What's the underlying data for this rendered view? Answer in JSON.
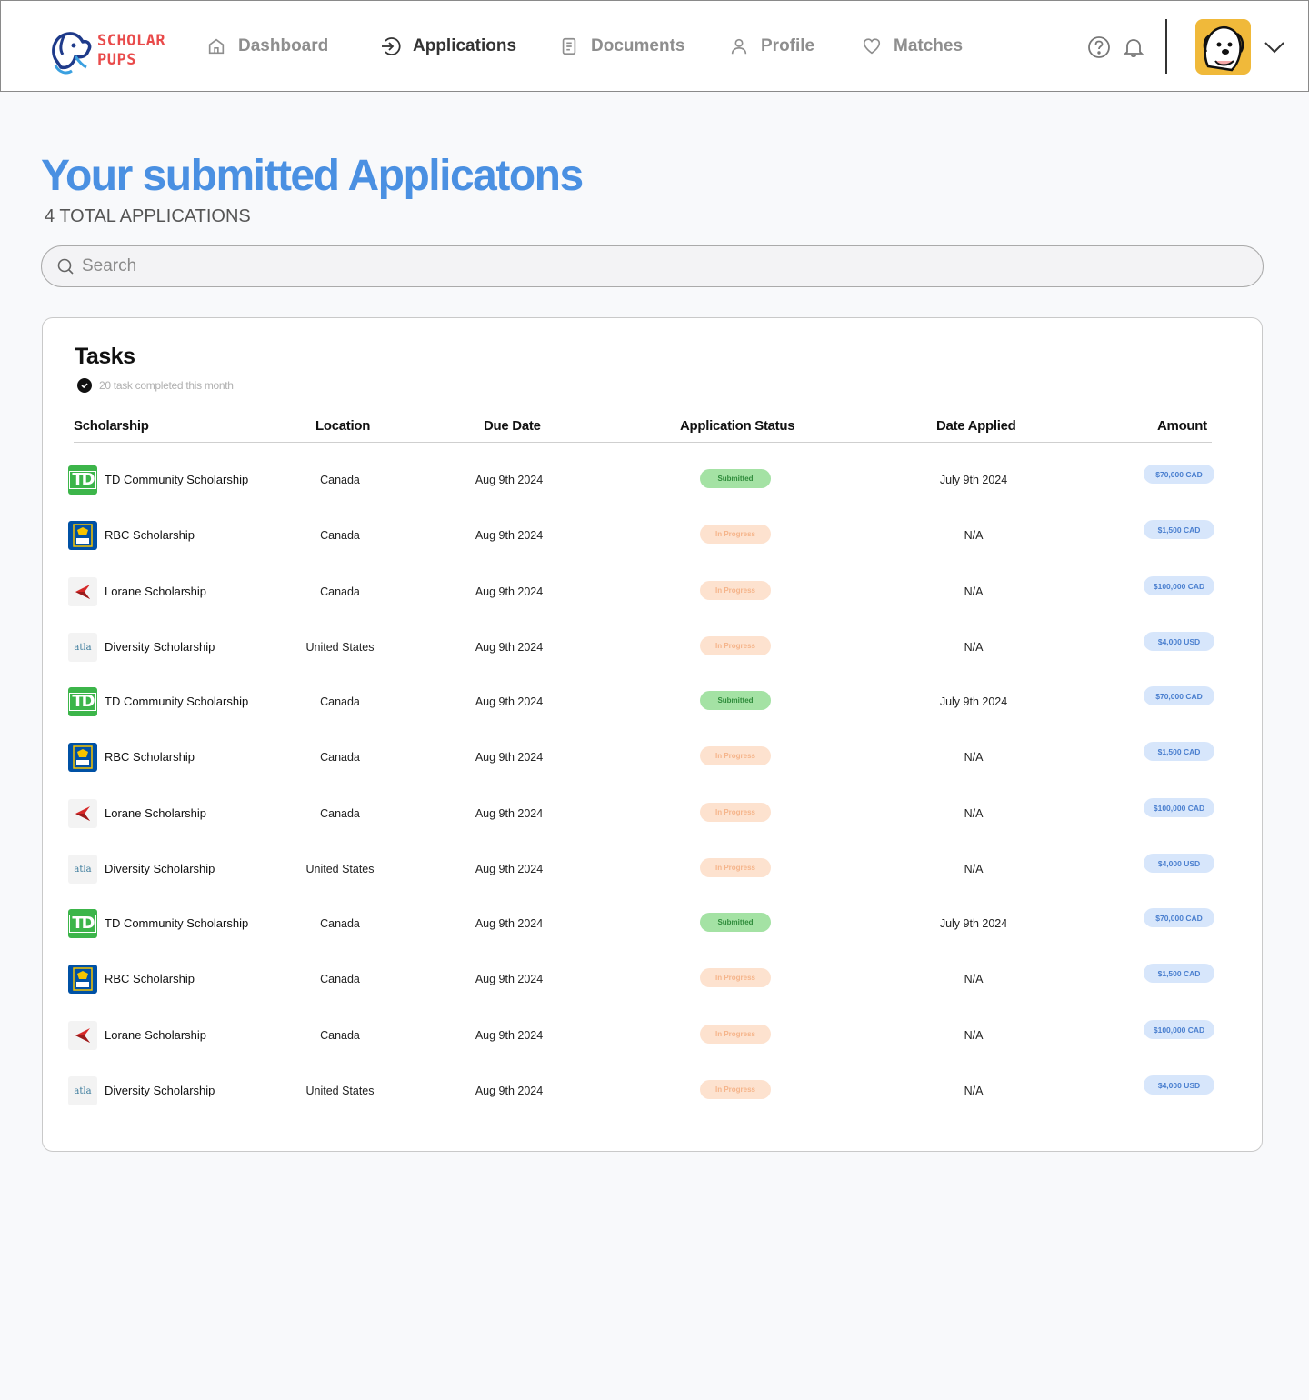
{
  "brand": {
    "line1": "SCHOLAR",
    "line2": "PUPS"
  },
  "nav": [
    {
      "label": "Dashboard",
      "icon": "home-icon",
      "active": false
    },
    {
      "label": "Applications",
      "icon": "arrow-in-icon",
      "active": true
    },
    {
      "label": "Documents",
      "icon": "document-icon",
      "active": false
    },
    {
      "label": "Profile",
      "icon": "user-icon",
      "active": false
    },
    {
      "label": "Matches",
      "icon": "heart-icon",
      "active": false
    }
  ],
  "page": {
    "title": "Your submitted Applicatons",
    "subtitle": "4 TOTAL APPLICATIONS"
  },
  "search": {
    "placeholder": "Search",
    "value": ""
  },
  "tasks": {
    "title": "Tasks",
    "subtitle": "20 task completed this month",
    "columns": [
      "Scholarship",
      "Location",
      "Due Date",
      "Application Status",
      "Date Applied",
      "Amount"
    ],
    "rows": [
      {
        "logo": "td",
        "name": "TD Community Scholarship",
        "location": "Canada",
        "due": "Aug 9th 2024",
        "status": "Submitted",
        "applied": "July 9th 2024",
        "amount": "$70,000 CAD"
      },
      {
        "logo": "rbc",
        "name": "RBC Scholarship",
        "location": "Canada",
        "due": "Aug 9th 2024",
        "status": "In Progress",
        "applied": "N/A",
        "amount": "$1,500 CAD"
      },
      {
        "logo": "lorane",
        "name": "Lorane Scholarship",
        "location": "Canada",
        "due": "Aug 9th 2024",
        "status": "In Progress",
        "applied": "N/A",
        "amount": "$100,000 CAD"
      },
      {
        "logo": "atla",
        "name": "Diversity Scholarship",
        "location": "United States",
        "due": "Aug 9th 2024",
        "status": "In Progress",
        "applied": "N/A",
        "amount": "$4,000 USD"
      },
      {
        "logo": "td",
        "name": "TD Community Scholarship",
        "location": "Canada",
        "due": "Aug 9th 2024",
        "status": "Submitted",
        "applied": "July 9th 2024",
        "amount": "$70,000 CAD"
      },
      {
        "logo": "rbc",
        "name": "RBC Scholarship",
        "location": "Canada",
        "due": "Aug 9th 2024",
        "status": "In Progress",
        "applied": "N/A",
        "amount": "$1,500 CAD"
      },
      {
        "logo": "lorane",
        "name": "Lorane Scholarship",
        "location": "Canada",
        "due": "Aug 9th 2024",
        "status": "In Progress",
        "applied": "N/A",
        "amount": "$100,000 CAD"
      },
      {
        "logo": "atla",
        "name": "Diversity Scholarship",
        "location": "United States",
        "due": "Aug 9th 2024",
        "status": "In Progress",
        "applied": "N/A",
        "amount": "$4,000 USD"
      },
      {
        "logo": "td",
        "name": "TD Community Scholarship",
        "location": "Canada",
        "due": "Aug 9th 2024",
        "status": "Submitted",
        "applied": "July 9th 2024",
        "amount": "$70,000 CAD"
      },
      {
        "logo": "rbc",
        "name": "RBC Scholarship",
        "location": "Canada",
        "due": "Aug 9th 2024",
        "status": "In Progress",
        "applied": "N/A",
        "amount": "$1,500 CAD"
      },
      {
        "logo": "lorane",
        "name": "Lorane Scholarship",
        "location": "Canada",
        "due": "Aug 9th 2024",
        "status": "In Progress",
        "applied": "N/A",
        "amount": "$100,000 CAD"
      },
      {
        "logo": "atla",
        "name": "Diversity Scholarship",
        "location": "United States",
        "due": "Aug 9th 2024",
        "status": "In Progress",
        "applied": "N/A",
        "amount": "$4,000 USD"
      }
    ]
  },
  "logo_text": {
    "td": "TD",
    "rbc": "RBC",
    "atla": "atla"
  },
  "colors": {
    "accent": "#4a90e2",
    "brand": "#e94b4b",
    "submitted": "#a4e2a4",
    "in_progress": "#fde2cf",
    "amount_bg": "#d7e6fb"
  }
}
